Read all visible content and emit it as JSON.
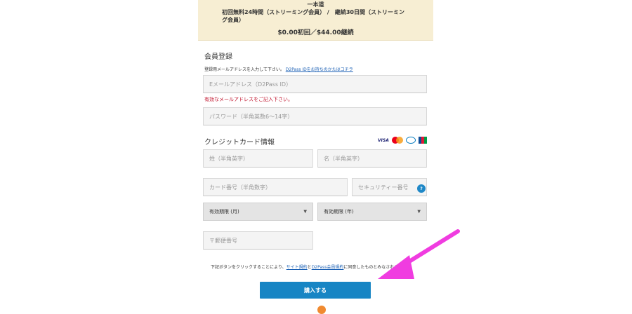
{
  "plan": {
    "title": "一本道",
    "description": "初回無料24時間（ストリーミング会員） /　継続30日間（ストリーミング会員）",
    "price": "$0.00初回／$44.00継続"
  },
  "member": {
    "title": "会員登録",
    "hint_text": "登録用メールアドレスを入力して下さい。",
    "hint_link": "D2Pass IDをお持ちのかたはコチラ",
    "email_placeholder": "Eメールアドレス（D2Pass ID）",
    "email_error": "有効なメールアドレスをご記入下さい。",
    "password_placeholder": "パスワード（半角英数6～14字）"
  },
  "card": {
    "title": "クレジットカード情報",
    "brands": [
      "VISA",
      "MasterCard",
      "Diners Club",
      "JCB"
    ],
    "visa_label": "VISA",
    "lastname_placeholder": "姓（半角英字）",
    "firstname_placeholder": "名（半角英字）",
    "number_placeholder": "カード番号（半角数字）",
    "cvv_placeholder": "セキュリティー番号",
    "help_label": "?",
    "exp_month": "有効期限 (月)",
    "exp_year": "有効期限 (年)",
    "zip_placeholder": "〒郵便番号"
  },
  "terms": {
    "prefix": "下記ボタンをクリックすることにより、",
    "site_terms": "サイト規約",
    "and": "と",
    "member_terms": "D2Pass会員規約",
    "suffix": "に同意したものとみなされます。"
  },
  "buy_label": "購入する",
  "colors": {
    "plan_bg": "#f7eed3",
    "button": "#1785c4",
    "error": "#c0122b",
    "annotation_arrow": "#f03ce0"
  }
}
